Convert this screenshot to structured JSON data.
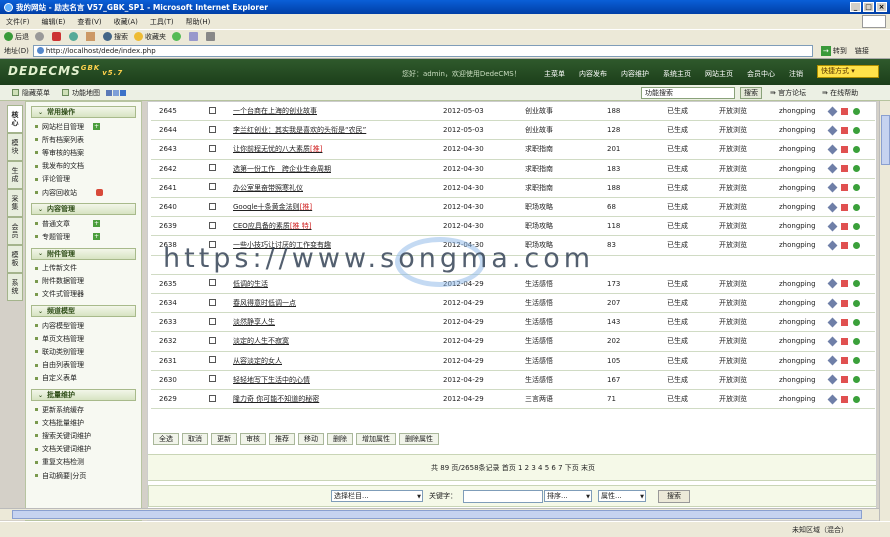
{
  "window": {
    "title": "我的网站 - 励志名言 V57_GBK_SP1 - Microsoft Internet Explorer"
  },
  "menu": [
    "文件(F)",
    "编辑(E)",
    "查看(V)",
    "收藏(A)",
    "工具(T)",
    "帮助(H)"
  ],
  "toolbar": {
    "back": "后退",
    "search": "搜索",
    "favorites": "收藏夹"
  },
  "address": {
    "label": "地址(D)",
    "url": "http://localhost/dede/index.php",
    "go": "转到",
    "links": "链接"
  },
  "header": {
    "logo": "DEDECMS",
    "logo_tag": "GBK",
    "version": "v5.7",
    "user": "您好：admin，欢迎使用DedeCMS！",
    "nav": [
      "主菜单",
      "内容发布",
      "内容维护",
      "系统主页",
      "网站主页",
      "会员中心",
      "注销"
    ],
    "quick": "快捷方式"
  },
  "subbar": {
    "hide_menu": "隐藏菜单",
    "sitemap": "功能地图",
    "search_placeholder": "功能搜索",
    "search_btn": "搜索",
    "forum": "官方论坛",
    "help": "在线帮助"
  },
  "vtabs": [
    "核心",
    "模块",
    "生成",
    "采集",
    "会员",
    "模板",
    "系统"
  ],
  "sidebar": [
    {
      "title": "常用操作",
      "items": [
        {
          "label": "网站栏目管理",
          "icon": "plus"
        },
        {
          "label": "所有档案列表"
        },
        {
          "label": "等审核的档案"
        },
        {
          "label": "我发布的文档"
        },
        {
          "label": "评论管理"
        },
        {
          "label": "内容回收站",
          "icon": "del"
        }
      ]
    },
    {
      "title": "内容管理",
      "items": [
        {
          "label": "普通文章",
          "icon": "plus"
        },
        {
          "label": "专题管理",
          "icon": "plus"
        }
      ]
    },
    {
      "title": "附件管理",
      "items": [
        {
          "label": "上传新文件"
        },
        {
          "label": "附件数据管理"
        },
        {
          "label": "文件式管理器"
        }
      ]
    },
    {
      "title": "频道模型",
      "items": [
        {
          "label": "内容模型管理"
        },
        {
          "label": "单页文档管理"
        },
        {
          "label": "联动类别管理"
        },
        {
          "label": "自由列表管理"
        },
        {
          "label": "自定义表单"
        }
      ]
    },
    {
      "title": "批量维护",
      "items": [
        {
          "label": "更新系统缓存"
        },
        {
          "label": "文档批量维护"
        },
        {
          "label": "搜索关键词维护"
        },
        {
          "label": "文档关键词维护"
        },
        {
          "label": "重复文档检测"
        },
        {
          "label": "自动摘要|分页"
        }
      ]
    }
  ],
  "rows": [
    {
      "id": "2645",
      "title": "一个台商在上海的创业故事",
      "flag": "",
      "date": "2012-05-03",
      "cat": "创业故事",
      "hits": "188",
      "status": "已生成",
      "access": "开放浏览",
      "user": "zhongping"
    },
    {
      "id": "2644",
      "title": "李兰红创业：其实我是喜欢的头衔是“农民”",
      "flag": "",
      "date": "2012-05-03",
      "cat": "创业故事",
      "hits": "128",
      "status": "已生成",
      "access": "开放浏览",
      "user": "zhongping"
    },
    {
      "id": "2643",
      "title": "让你前程无忧的八大素质",
      "flag": "[推]",
      "date": "2012-04-30",
      "cat": "求职指南",
      "hits": "201",
      "status": "已生成",
      "access": "开放浏览",
      "user": "zhongping"
    },
    {
      "id": "2642",
      "title": "选第一份工作　跨企业生命周期",
      "flag": "",
      "date": "2012-04-30",
      "cat": "求职指南",
      "hits": "183",
      "status": "已生成",
      "access": "开放浏览",
      "user": "zhongping"
    },
    {
      "id": "2641",
      "title": "办公室里奋带照寒礼仪",
      "flag": "",
      "date": "2012-04-30",
      "cat": "求职指南",
      "hits": "188",
      "status": "已生成",
      "access": "开放浏览",
      "user": "zhongping"
    },
    {
      "id": "2640",
      "title": "Google十条黄金法则",
      "flag": "[推]",
      "date": "2012-04-30",
      "cat": "职场攻略",
      "hits": "68",
      "status": "已生成",
      "access": "开放浏览",
      "user": "zhongping"
    },
    {
      "id": "2639",
      "title": "CEO应具备的素质",
      "flag": "[推 特]",
      "date": "2012-04-30",
      "cat": "职场攻略",
      "hits": "118",
      "status": "已生成",
      "access": "开放浏览",
      "user": "zhongping"
    },
    {
      "id": "2638",
      "title": "一些小技巧让讨厌的工作变有趣",
      "flag": "",
      "date": "2012-04-30",
      "cat": "职场攻略",
      "hits": "83",
      "status": "已生成",
      "access": "开放浏览",
      "user": "zhongping"
    },
    {
      "id": "",
      "title": "",
      "flag": "",
      "date": "",
      "cat": "",
      "hits": "",
      "status": "",
      "access": "",
      "user": ""
    },
    {
      "id": "2635",
      "title": "低调的生活",
      "flag": "",
      "date": "2012-04-29",
      "cat": "生活感悟",
      "hits": "173",
      "status": "已生成",
      "access": "开放浏览",
      "user": "zhongping"
    },
    {
      "id": "2634",
      "title": "春风得意时低调一点",
      "flag": "",
      "date": "2012-04-29",
      "cat": "生活感悟",
      "hits": "207",
      "status": "已生成",
      "access": "开放浏览",
      "user": "zhongping"
    },
    {
      "id": "2633",
      "title": "淡然静享人生",
      "flag": "",
      "date": "2012-04-29",
      "cat": "生活感悟",
      "hits": "143",
      "status": "已生成",
      "access": "开放浏览",
      "user": "zhongping"
    },
    {
      "id": "2632",
      "title": "淡定的人生不寂寞",
      "flag": "",
      "date": "2012-04-29",
      "cat": "生活感悟",
      "hits": "202",
      "status": "已生成",
      "access": "开放浏览",
      "user": "zhongping"
    },
    {
      "id": "2631",
      "title": "从容淡定的女人",
      "flag": "",
      "date": "2012-04-29",
      "cat": "生活感悟",
      "hits": "105",
      "status": "已生成",
      "access": "开放浏览",
      "user": "zhongping"
    },
    {
      "id": "2630",
      "title": "轻轻地写下生活中的心情",
      "flag": "",
      "date": "2012-04-29",
      "cat": "生活感悟",
      "hits": "167",
      "status": "已生成",
      "access": "开放浏览",
      "user": "zhongping"
    },
    {
      "id": "2629",
      "title": "隆力奇 你可能不知道的秘密",
      "flag": "",
      "date": "2012-04-29",
      "cat": "三言两语",
      "hits": "71",
      "status": "已生成",
      "access": "开放浏览",
      "user": "zhongping"
    }
  ],
  "actions": [
    "全选",
    "取消",
    "更新",
    "审核",
    "推荐",
    "移动",
    "删除",
    "增加属性",
    "删除属性"
  ],
  "pager": {
    "text": "共 89 页/2658条记录 首页 1 2 3 4 5 6 7 下页 末页"
  },
  "search": {
    "category": "选择栏目...",
    "keyword_label": "关键字：",
    "sort": "排序...",
    "attr": "属性...",
    "btn": "搜索"
  },
  "watermark": "https://www.songma.com",
  "status": {
    "zone": "未知区域（混合）"
  }
}
